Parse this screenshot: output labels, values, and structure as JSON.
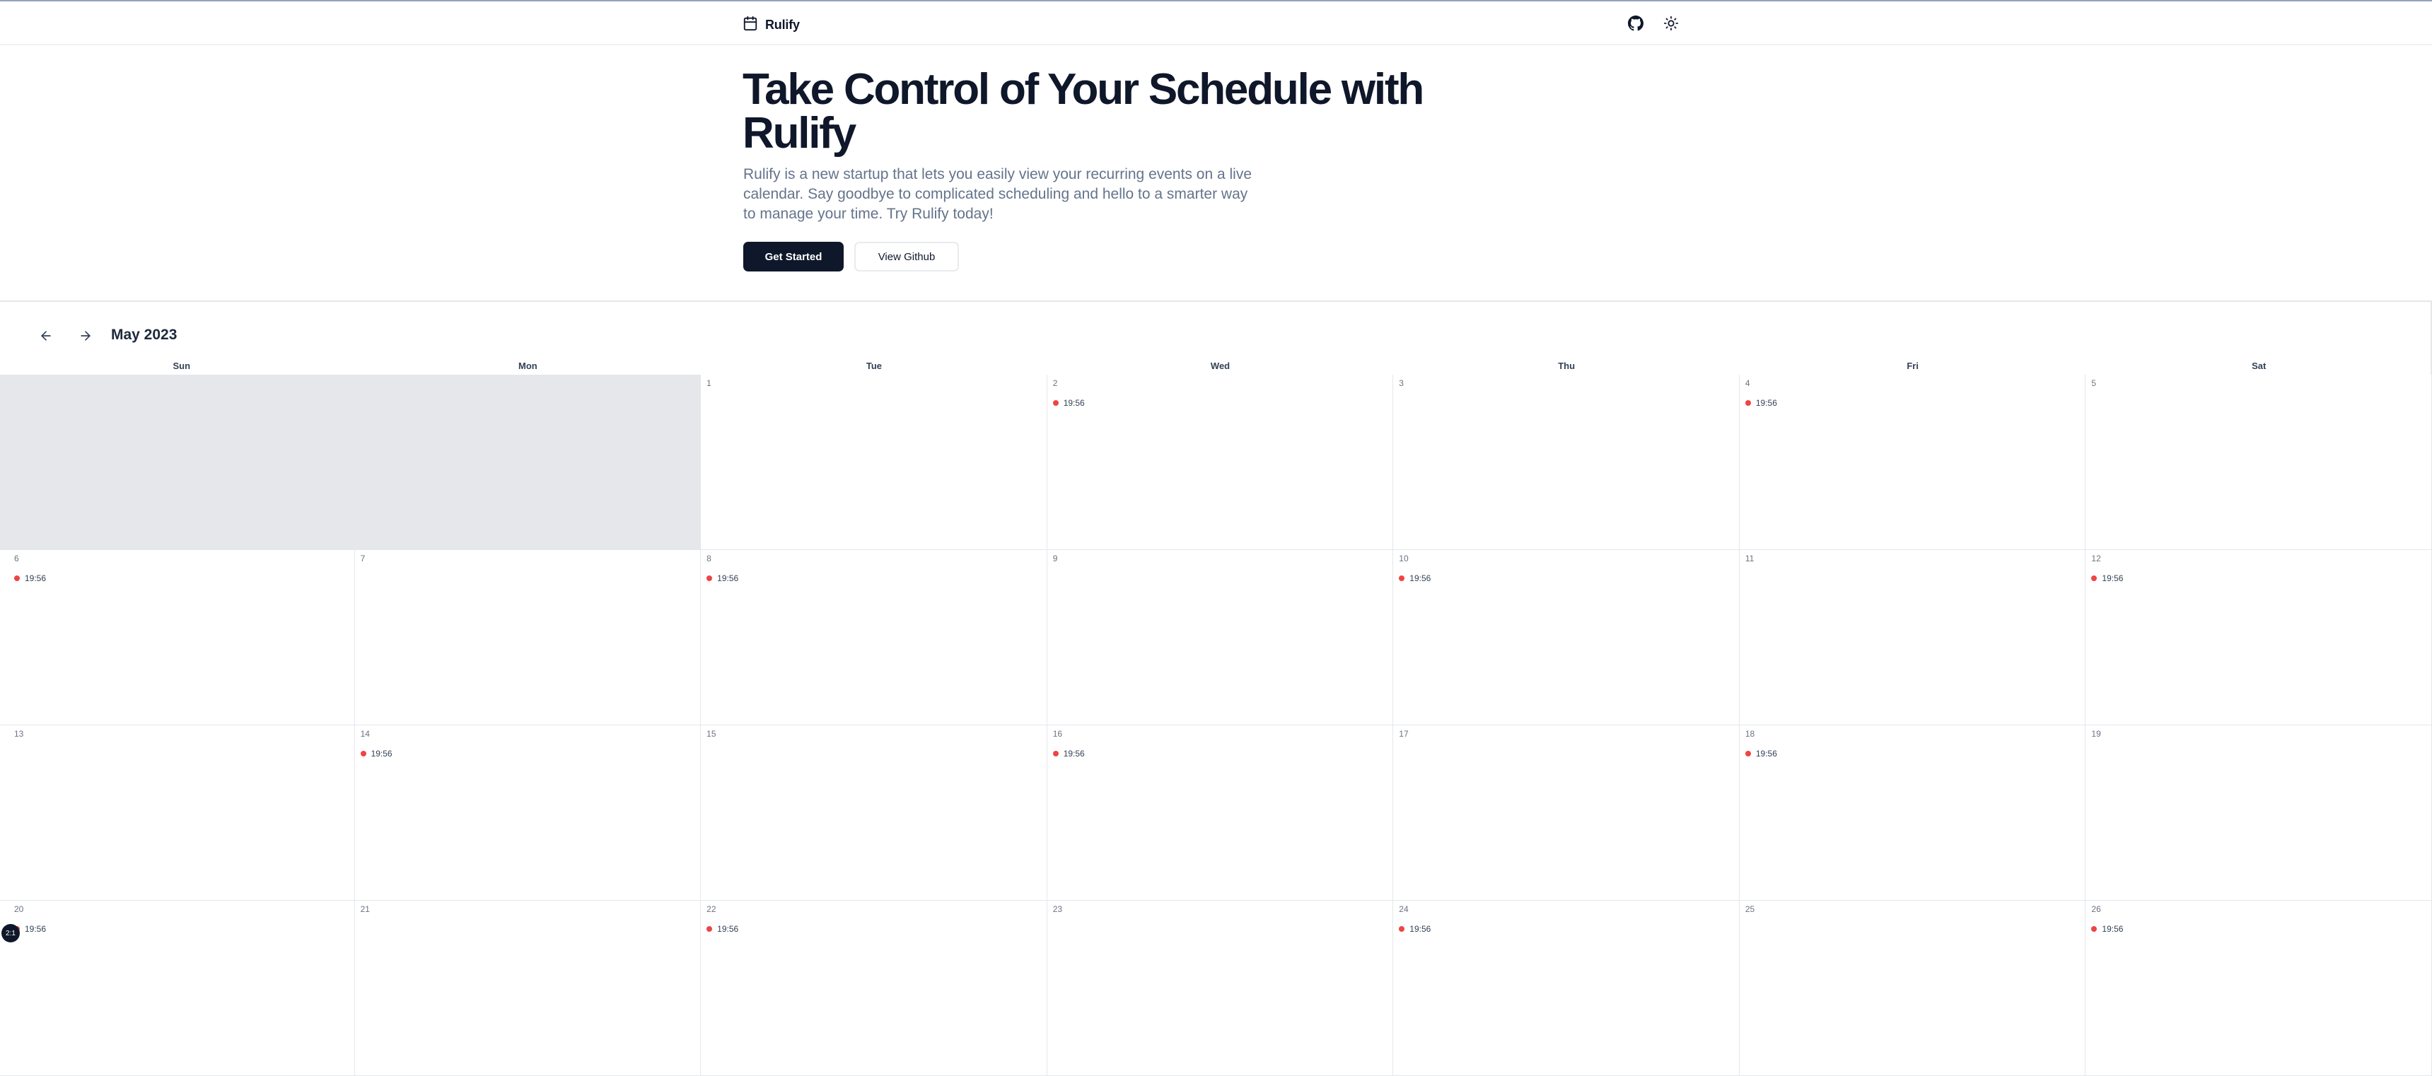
{
  "header": {
    "brand": "Rulify",
    "icons": {
      "brand": "calendar-icon",
      "github": "github-icon",
      "theme": "sun-icon"
    }
  },
  "hero": {
    "title": "Take Control of Your Schedule with Rulify",
    "description": "Rulify is a new startup that lets you easily view your recurring events on a live calendar. Say goodbye to complicated scheduling and hello to a smarter way to manage your time. Try Rulify today!",
    "primary_button": "Get Started",
    "secondary_button": "View Github"
  },
  "calendar": {
    "title": "May 2023",
    "weekdays": [
      "Sun",
      "Mon",
      "Tue",
      "Wed",
      "Thu",
      "Fri",
      "Sat"
    ],
    "leading_empty_days": 2,
    "event_color": "#ef4444",
    "days": [
      {
        "day": "1",
        "events": []
      },
      {
        "day": "2",
        "events": [
          "19:56"
        ]
      },
      {
        "day": "3",
        "events": []
      },
      {
        "day": "4",
        "events": [
          "19:56"
        ]
      },
      {
        "day": "5",
        "events": []
      },
      {
        "day": "6",
        "events": [
          "19:56"
        ]
      },
      {
        "day": "7",
        "events": []
      },
      {
        "day": "8",
        "events": [
          "19:56"
        ]
      },
      {
        "day": "9",
        "events": []
      },
      {
        "day": "10",
        "events": [
          "19:56"
        ]
      },
      {
        "day": "11",
        "events": []
      },
      {
        "day": "12",
        "events": [
          "19:56"
        ]
      },
      {
        "day": "13",
        "events": []
      },
      {
        "day": "14",
        "events": [
          "19:56"
        ]
      },
      {
        "day": "15",
        "events": []
      },
      {
        "day": "16",
        "events": [
          "19:56"
        ]
      },
      {
        "day": "17",
        "events": []
      },
      {
        "day": "18",
        "events": [
          "19:56"
        ]
      },
      {
        "day": "19",
        "events": []
      },
      {
        "day": "20",
        "events": [
          "19:56"
        ]
      },
      {
        "day": "21",
        "events": []
      },
      {
        "day": "22",
        "events": [
          "19:56"
        ]
      },
      {
        "day": "23",
        "events": []
      },
      {
        "day": "24",
        "events": [
          "19:56"
        ]
      },
      {
        "day": "25",
        "events": []
      },
      {
        "day": "26",
        "events": [
          "19:56"
        ]
      }
    ]
  },
  "overlay": {
    "avatar_text": "2:1"
  }
}
